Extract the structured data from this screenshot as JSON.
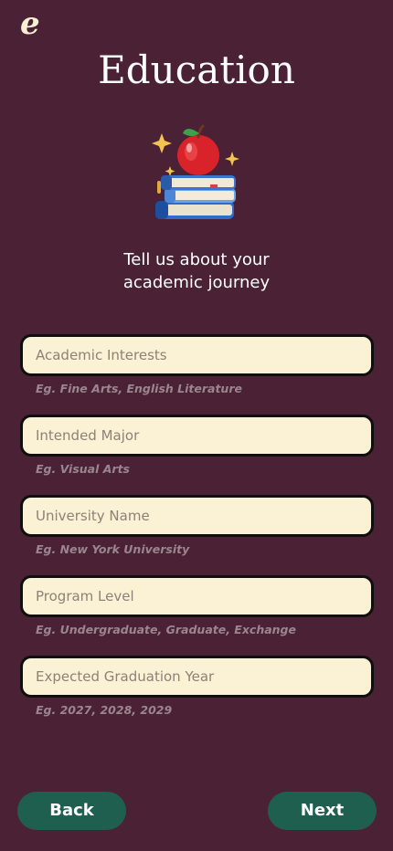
{
  "app": {
    "logo_text": "e",
    "page_title": "Education"
  },
  "intro": {
    "line1": "Tell us about your",
    "line2": "academic journey"
  },
  "form": {
    "fields": [
      {
        "placeholder": "Academic Interests",
        "hint": "Eg. Fine Arts, English Literature"
      },
      {
        "placeholder": "Intended Major",
        "hint": "Eg. Visual Arts"
      },
      {
        "placeholder": "University Name",
        "hint": "Eg. New York University"
      },
      {
        "placeholder": "Program Level",
        "hint": "Eg. Undergraduate, Graduate, Exchange"
      },
      {
        "placeholder": "Expected Graduation Year",
        "hint": "Eg. 2027, 2028, 2029"
      }
    ]
  },
  "nav": {
    "back_label": "Back",
    "next_label": "Next"
  },
  "illustration": {
    "icon": "apple-on-books-icon"
  },
  "colors": {
    "background": "#4a2135",
    "field_bg": "#fbf1d5",
    "button": "#1f5f50"
  }
}
